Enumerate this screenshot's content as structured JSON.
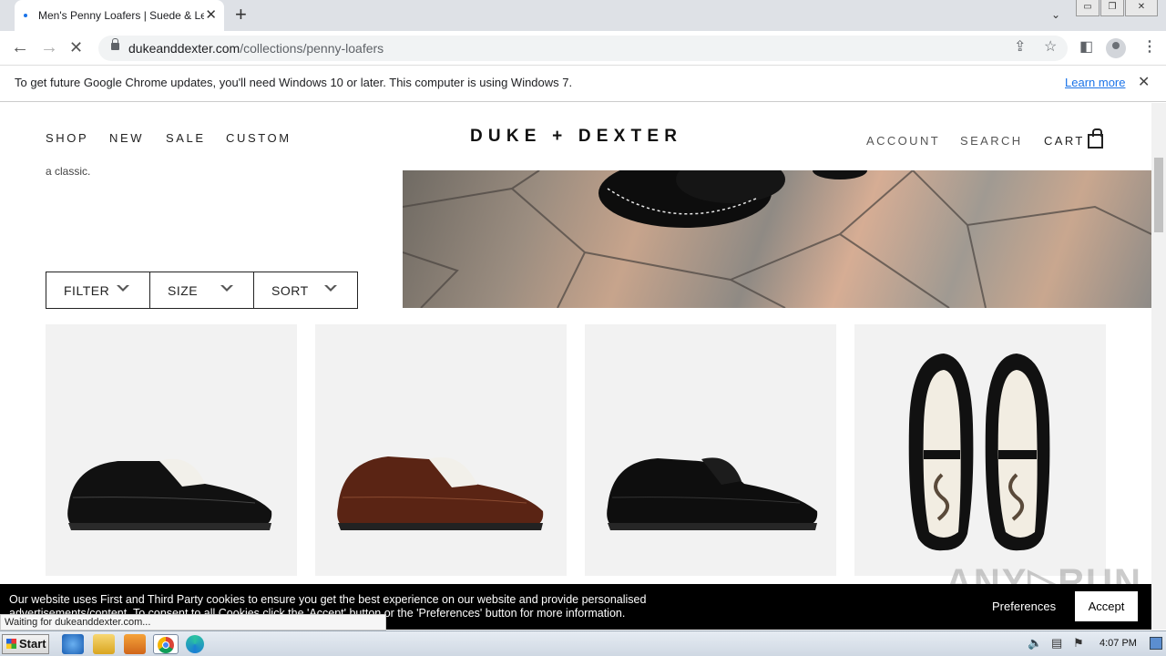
{
  "browser": {
    "tab_title": "Men's Penny Loafers | Suede & Leat",
    "url_domain": "dukeanddexter.com",
    "url_path": "/collections/penny-loafers",
    "new_tab": "+",
    "tab_close": "✕",
    "win_buttons": [
      "▭",
      "❐",
      "✕"
    ]
  },
  "infobar": {
    "message": "To get future Google Chrome updates, you'll need Windows 10 or later. This computer is using Windows 7.",
    "learn_more": "Learn more",
    "close": "✕"
  },
  "site": {
    "nav_left": [
      "SHOP",
      "NEW",
      "SALE",
      "CUSTOM"
    ],
    "logo": "DUKE + DEXTER",
    "nav_right": [
      "ACCOUNT",
      "SEARCH",
      "CART"
    ],
    "intro_fragment": "a classic."
  },
  "filters": [
    "FILTER",
    "SIZE",
    "SORT"
  ],
  "products": [
    {
      "name": "black-white-penny-loafer",
      "upper": "#111111",
      "saddle": "#f2f0ea"
    },
    {
      "name": "brown-white-penny-loafer",
      "upper": "#5a2414",
      "saddle": "#f2f0ea"
    },
    {
      "name": "black-penny-loafer",
      "upper": "#111111",
      "saddle": "#111111"
    },
    {
      "name": "snake-print-penny-loafer",
      "upper": "#111111",
      "saddle": "#f2ede2"
    }
  ],
  "cookie": {
    "text": "Our website uses First and Third Party cookies to ensure you get the best experience on our website and provide personalised advertisements/content. To consent to all Cookies click the 'Accept' button or the 'Preferences' button for more information.",
    "preferences": "Preferences",
    "accept": "Accept"
  },
  "watermark": "ANY RUN",
  "status_bar": "Waiting for dukeanddexter.com...",
  "taskbar": {
    "start": "Start",
    "clock": "4:07 PM"
  }
}
